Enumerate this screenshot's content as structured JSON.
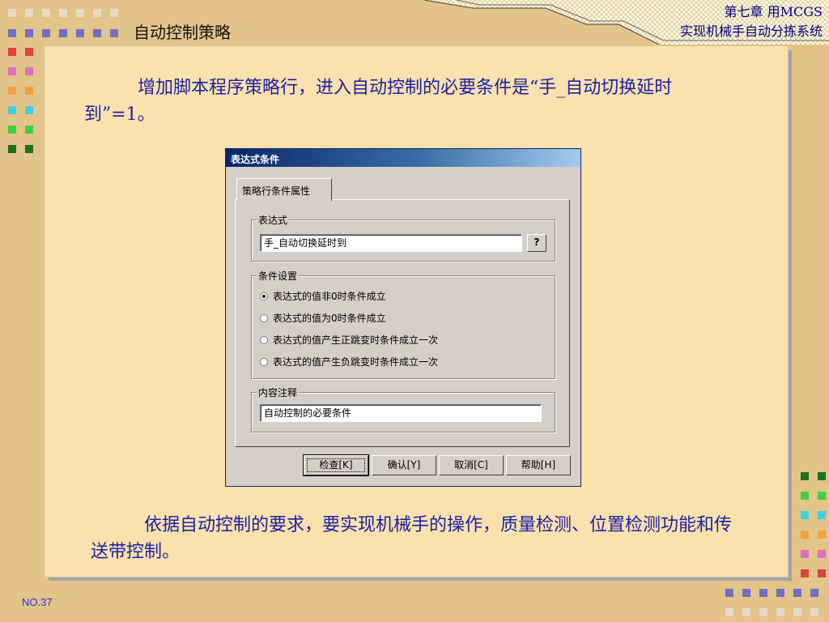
{
  "slide": {
    "title": "自动控制策略",
    "chapter_line1": "第七章 用MCGS",
    "chapter_line2": "实现机械手自动分拣系统",
    "paragraph1": "增加脚本程序策略行，进入自动控制的必要条件是“手_自动切换延时到”=1。",
    "paragraph2": "依据自动控制的要求，要实现机械手的操作，质量检测、位置检测功能和传送带控制。",
    "page_number": "NO.37"
  },
  "dialog": {
    "title": "表达式条件",
    "tab_label": "策略行条件属性",
    "expression_group_label": "表达式",
    "expression_value": "手_自动切换延时到",
    "help_button": "?",
    "condition_group_label": "条件设置",
    "options": [
      {
        "label": "表达式的值非0时条件成立",
        "selected": true
      },
      {
        "label": "表达式的值为0时条件成立",
        "selected": false
      },
      {
        "label": "表达式的值产生正跳变时条件成立一次",
        "selected": false
      },
      {
        "label": "表达式的值产生负跳变时条件成立一次",
        "selected": false
      }
    ],
    "comment_group_label": "内容注释",
    "comment_value": "自动控制的必要条件",
    "buttons": {
      "check": "检查[K]",
      "ok": "确认[Y]",
      "cancel": "取消[C]",
      "help": "帮助[H]"
    }
  },
  "colors": {
    "background": "#e3c489",
    "panel": "#fbe1ad",
    "text_blue": "#1b22a6",
    "dialog_face": "#d4d0c8",
    "titlebar": "#0a246a"
  }
}
